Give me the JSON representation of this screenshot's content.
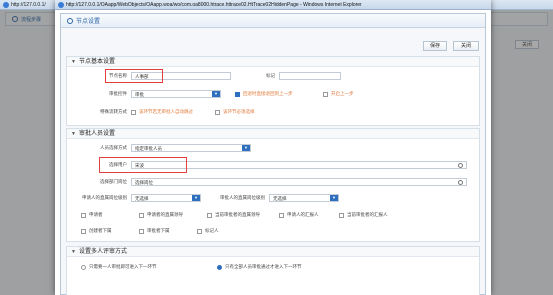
{
  "background_window": {
    "title": "http://127.0.0.1/",
    "tab_label": "流程步骤",
    "close_label": "关闭"
  },
  "popup": {
    "title": "http://127.0.0.1/OAapp/WebObjects/OAapp.woa/wo/com.oa8000.htrace.httrace02.HtTrace02HiddenPage - Windows Internet Explorer",
    "header": "节点设置",
    "save_label": "保存",
    "close_label": "关闭"
  },
  "basic_section": {
    "title": "节点基本设置",
    "node_name_label": "节点名称",
    "node_name_value": "人事部",
    "mark_label": "标记",
    "mark_value": "",
    "approve_label": "审批控件",
    "approve_value": "审批",
    "cb_return_prev": "回退时直接退回到上一步",
    "cb_prev_step": "开启上一步",
    "special_label": "特殊流转方式",
    "cb_special1": "该环节若无审批人自动跳过",
    "cb_special2": "该环节必须选择"
  },
  "approver_section": {
    "title": "审批人员设置",
    "approver_type_label": "人员选择方式",
    "approver_type_value": "指定审批人员",
    "select_user_label": "选择用户",
    "select_user_value": "宋波",
    "select_dept_label": "选择部门岗位",
    "select_dept_value": "选择岗位",
    "apply_level_label": "申请人的直属岗位级别",
    "apply_level_value": "无选择",
    "approve_level_label": "审批人的直属岗位级别",
    "approve_level_value": "无选择",
    "checkboxes_row1": [
      "申请者",
      "申请者的直属领导",
      "当前审批者的直属领导",
      "申请人的汇报人",
      "当前审批者的汇报人"
    ],
    "checkboxes_row2": [
      "创建者下属",
      "审批者下属",
      "标记人"
    ]
  },
  "multi_section": {
    "title": "设置多人评审方式",
    "radio1": "只需要一人审批即可进入下一环节",
    "radio2": "只有全部人员审批通过才进入下一环节"
  }
}
